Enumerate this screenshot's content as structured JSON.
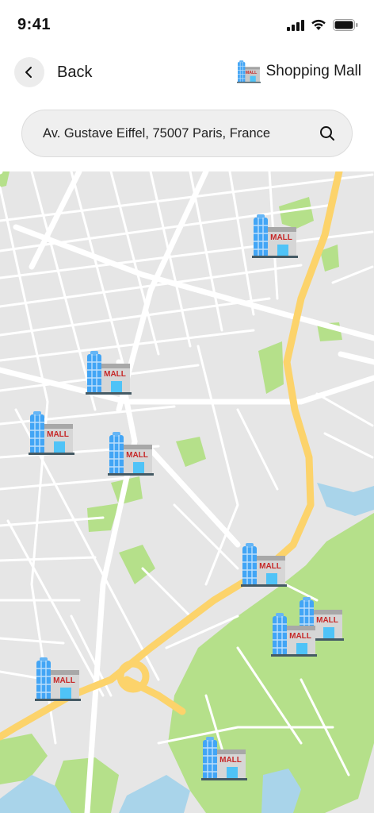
{
  "status": {
    "time": "9:41"
  },
  "nav": {
    "back_label": "Back",
    "category_label": "Shopping Mall"
  },
  "search": {
    "value": "Av. Gustave Eiffel, 75007 Paris, France"
  },
  "map": {
    "marker_label": "MALL",
    "colors": {
      "road_major": "#fcd36b",
      "park": "#b5e08a",
      "water": "#a9d4ea",
      "land": "#e6e6e6"
    }
  }
}
